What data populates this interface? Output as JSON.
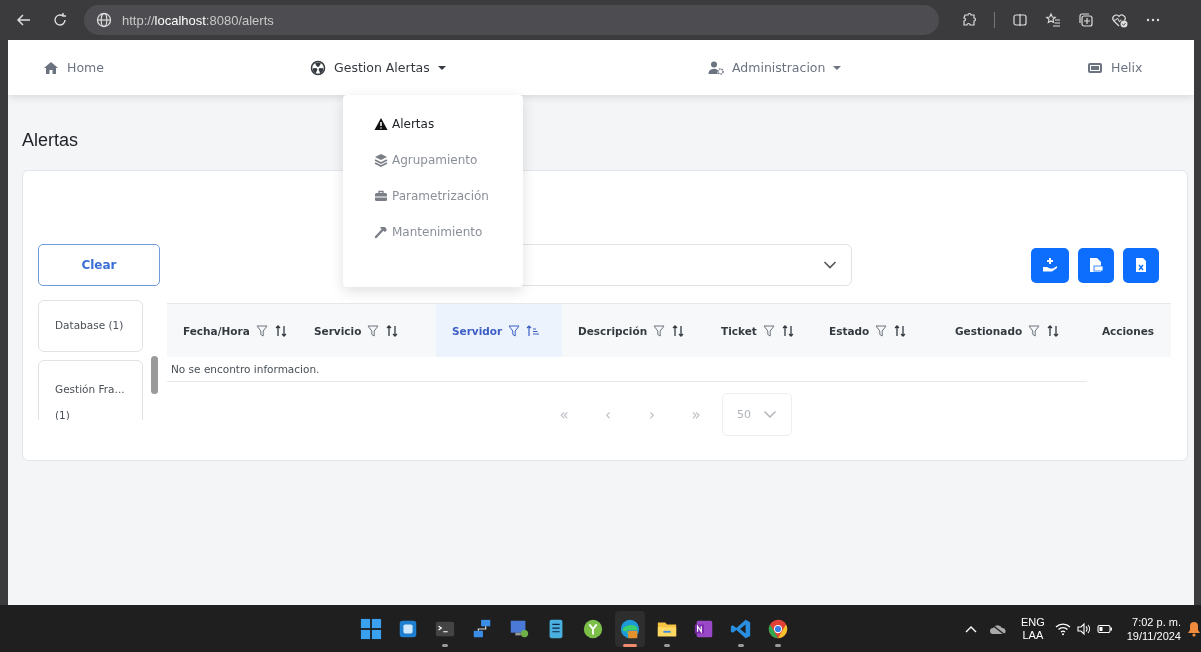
{
  "browser": {
    "url": "http://**localhost**:8080/alerts"
  },
  "nav": {
    "items": [
      {
        "label": "Home",
        "menu": false,
        "open": false
      },
      {
        "label": "Gestion Alertas",
        "menu": true,
        "open": true
      },
      {
        "label": "Administracion",
        "menu": true,
        "open": false
      },
      {
        "label": "Helix",
        "menu": false,
        "open": false
      }
    ]
  },
  "dropdown": {
    "items": [
      {
        "label": "Alertas",
        "selected": true
      },
      {
        "label": "Agrupamiento",
        "selected": false
      },
      {
        "label": "Parametrización",
        "selected": false
      },
      {
        "label": "Mantenimiento",
        "selected": false
      }
    ]
  },
  "page": {
    "title": "Alertas"
  },
  "toolbar": {
    "clear_button": "Clear"
  },
  "groups": [
    {
      "label": "Database (1)"
    },
    {
      "label": "Gestión Fra... (1)"
    }
  ],
  "table": {
    "columns": [
      {
        "label": "Fecha/Hora",
        "sortable": true,
        "sorted": false
      },
      {
        "label": "Servicio",
        "sortable": true,
        "sorted": false
      },
      {
        "label": "Servidor",
        "sortable": true,
        "sorted": true
      },
      {
        "label": "Descripción",
        "sortable": true,
        "sorted": false
      },
      {
        "label": "Ticket",
        "sortable": true,
        "sorted": false
      },
      {
        "label": "Estado",
        "sortable": true,
        "sorted": false
      },
      {
        "label": "Gestionado",
        "sortable": true,
        "sorted": false
      },
      {
        "label": "Acciones",
        "sortable": false,
        "sorted": false
      }
    ],
    "empty_message": "No se encontro informacion."
  },
  "pagination": {
    "buttons": [
      {
        "label": "«",
        "disabled": true
      },
      {
        "label": "‹",
        "disabled": true
      },
      {
        "label": "›",
        "disabled": true
      },
      {
        "label": "»",
        "disabled": true
      }
    ],
    "page_size": "50"
  },
  "taskbar": {
    "apps": [
      {
        "running": false,
        "active": false
      },
      {
        "running": false,
        "active": false
      },
      {
        "running": true,
        "active": false
      },
      {
        "running": false,
        "active": false
      },
      {
        "running": false,
        "active": false
      },
      {
        "running": false,
        "active": false
      },
      {
        "running": false,
        "active": false
      },
      {
        "running": true,
        "active": true
      },
      {
        "running": true,
        "active": false
      },
      {
        "running": false,
        "active": false
      },
      {
        "running": true,
        "active": false
      },
      {
        "running": true,
        "active": false
      }
    ],
    "tray": {
      "language": "ENG",
      "layout": "LAA",
      "time": "7:02 p. m.",
      "date": "19/11/2024"
    }
  }
}
